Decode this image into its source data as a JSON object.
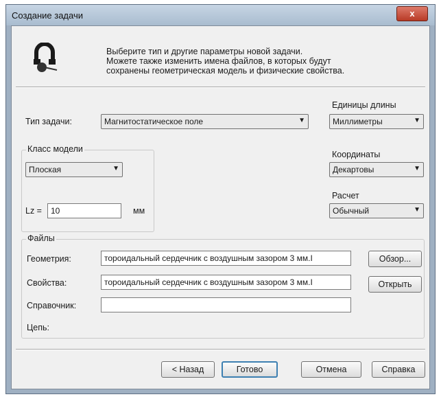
{
  "window": {
    "title": "Создание задачи",
    "close": "x"
  },
  "intro": {
    "line1": "Выберите тип и другие параметры новой задачи.",
    "line2": "Можете также изменить имена файлов, в которых будут",
    "line3": "сохранены геометрическая модель и физические свойства."
  },
  "task_type": {
    "label": "Тип задачи:",
    "value": "Магнитостатическое поле"
  },
  "length_units": {
    "label": "Единицы длины",
    "value": "Миллиметры"
  },
  "model_class": {
    "label": "Класс модели",
    "value": "Плоская",
    "lz_label": "Lz =",
    "lz_value": "10",
    "lz_unit": "мм"
  },
  "coordinates": {
    "label": "Координаты",
    "value": "Декартовы"
  },
  "calculation": {
    "label": "Расчет",
    "value": "Обычный"
  },
  "files": {
    "label": "Файлы",
    "geometry_label": "Геометрия:",
    "geometry_value": "тороидальный сердечник с воздушным зазором 3 мм.I",
    "properties_label": "Свойства:",
    "properties_value": "тороидальный сердечник с воздушным зазором 3 мм.I",
    "reference_label": "Справочник:",
    "reference_value": "",
    "circuit_label": "Цепь:",
    "browse": "Обзор...",
    "open": "Открыть"
  },
  "buttons": {
    "back": "< Назад",
    "done": "Готово",
    "cancel": "Отмена",
    "help": "Справка"
  }
}
